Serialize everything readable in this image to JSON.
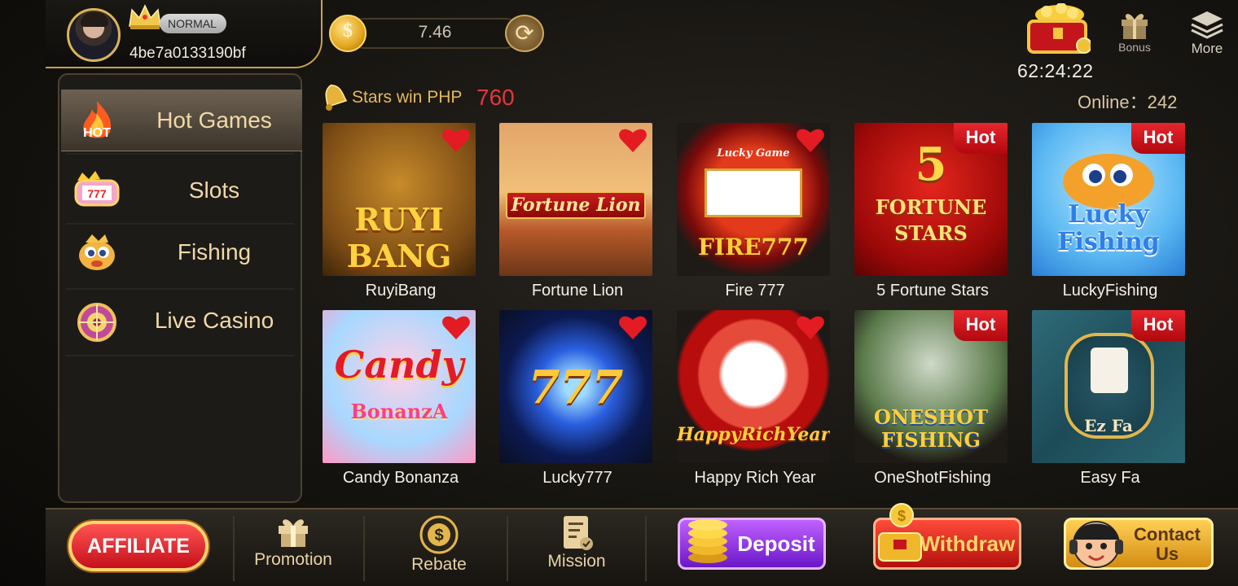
{
  "profile": {
    "vip_level": "NORMAL",
    "user_id": "4be7a0133190bf"
  },
  "wallet": {
    "balance": "7.46"
  },
  "header": {
    "countdown": "62:24:22",
    "bonus_label": "Bonus",
    "more_label": "More"
  },
  "online": {
    "text": "Online：242"
  },
  "jackpot": {
    "text": "Stars win PHP",
    "amount": "760"
  },
  "sidebar": {
    "items": [
      {
        "label": "Hot Games",
        "icon": "hot-flame-icon",
        "active": true
      },
      {
        "label": "Slots",
        "icon": "slot-machine-icon",
        "active": false
      },
      {
        "label": "Fishing",
        "icon": "fish-icon",
        "active": false
      },
      {
        "label": "Live Casino",
        "icon": "roulette-wheel-icon",
        "active": false
      }
    ],
    "hot_badge_text": "HOT"
  },
  "games": [
    {
      "name": "RuyiBang",
      "art_text": "RUYI BANG",
      "badge": "heart"
    },
    {
      "name": "Fortune Lion",
      "art_text": "Fortune Lion",
      "badge": "heart"
    },
    {
      "name": "Fire 777",
      "art_text": "FIRE777",
      "art_sub": "Lucky Game",
      "badge": "heart"
    },
    {
      "name": "5 Fortune Stars",
      "art_text": "FORTUNE STARS",
      "art_num": "5",
      "badge": "Hot"
    },
    {
      "name": "LuckyFishing",
      "art_text": "Lucky Fishing",
      "badge": "Hot"
    },
    {
      "name": "Candy Bonanza",
      "art_text": "Candy",
      "art_sub": "BonanzA",
      "badge": "heart"
    },
    {
      "name": "Lucky777",
      "art_text": "777",
      "badge": "heart"
    },
    {
      "name": "Happy Rich Year",
      "art_text": "HappyRichYear",
      "badge": "heart"
    },
    {
      "name": "OneShotFishing",
      "art_text": "ONESHOT FISHING",
      "badge": "Hot"
    },
    {
      "name": "Easy Fa",
      "art_text": "Ez Fa",
      "badge": "Hot"
    }
  ],
  "bottom_nav": {
    "affiliate": "AFFILIATE",
    "promotion": "Promotion",
    "rebate": "Rebate",
    "mission": "Mission",
    "deposit": "Deposit",
    "withdraw": "Withdraw",
    "contact_line1": "Contact",
    "contact_line2": "Us"
  },
  "colors": {
    "gold": "#d9b45a",
    "hot_red": "#e8262d",
    "jackpot_red": "#e4363a",
    "deposit_purple": "#9b3fe8"
  }
}
